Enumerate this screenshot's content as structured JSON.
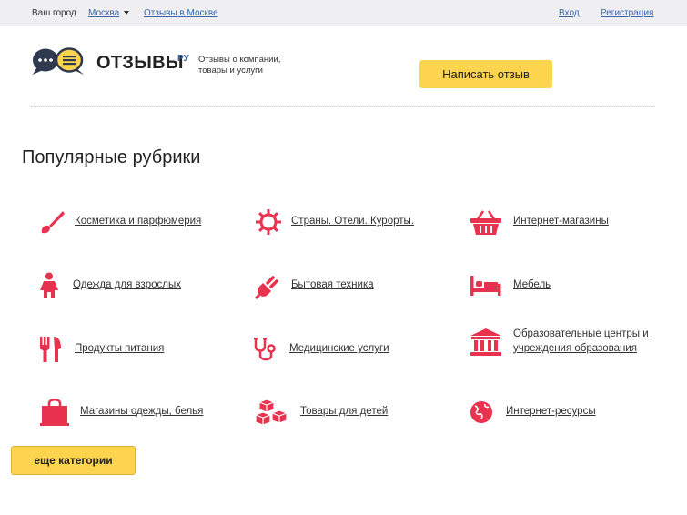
{
  "topbar": {
    "city_label": "Ваш город",
    "city_value": "Москва",
    "city_reviews": "Отзывы в Москве",
    "login": "Вход",
    "register": "Регистрация"
  },
  "header": {
    "logo_text": "ОТЗЫВЫ",
    "logo_sup": "РУ",
    "tagline": "Отзывы о компании, товары и услуги",
    "write_review": "Написать отзыв"
  },
  "section_title": "Популярные рубрики",
  "categories": [
    {
      "label": "Косметика и парфюмерия",
      "icon": "brush-icon"
    },
    {
      "label": "Страны. Отели. Курорты.",
      "icon": "sun-icon"
    },
    {
      "label": "Интернет-магазины",
      "icon": "basket-icon"
    },
    {
      "label": "Одежда для взрослых",
      "icon": "person-icon"
    },
    {
      "label": "Бытовая техника",
      "icon": "plug-icon"
    },
    {
      "label": "Мебель",
      "icon": "bed-icon"
    },
    {
      "label": "Продукты питания",
      "icon": "fork-knife-icon"
    },
    {
      "label": "Медицинские услуги",
      "icon": "stethoscope-icon"
    },
    {
      "label": "Образовательные центры и учреждения образования",
      "icon": "building-icon"
    },
    {
      "label": "Магазины одежды, белья",
      "icon": "shopping-bag-icon"
    },
    {
      "label": "Товары для детей",
      "icon": "cubes-icon"
    },
    {
      "label": "Интернет-ресурсы",
      "icon": "globe-icon"
    }
  ],
  "more_button": "еще категории",
  "colors": {
    "accent_yellow": "#fcd44e",
    "icon_red": "#e8334f",
    "link_blue": "#3b67a8",
    "logo_navy": "#2f3a4f"
  }
}
